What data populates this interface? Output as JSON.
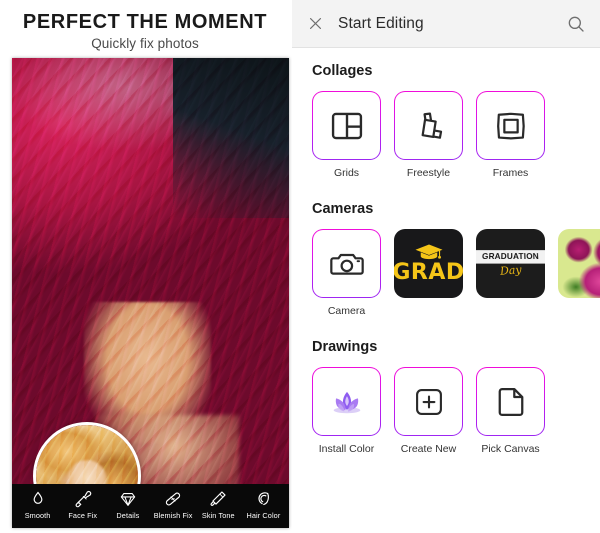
{
  "promo": {
    "title": "PERFECT THE MOMENT",
    "subtitle": "Quickly fix photos",
    "hero_photo": "woman-with-pink-hair-photo",
    "inset_photo": "woman-with-blonde-hair-thumbnail",
    "toolbar": [
      {
        "label": "Smooth",
        "icon": "droplet-icon"
      },
      {
        "label": "Face Fix",
        "icon": "brush-icon"
      },
      {
        "label": "Details",
        "icon": "diamond-icon"
      },
      {
        "label": "Blemish Fix",
        "icon": "bandage-icon"
      },
      {
        "label": "Skin Tone",
        "icon": "lipstick-icon"
      },
      {
        "label": "Hair Color",
        "icon": "hair-swirl-icon"
      }
    ]
  },
  "app": {
    "header": {
      "title": "Start Editing",
      "close_icon": "close-icon",
      "search_icon": "search-icon"
    },
    "sections": [
      {
        "title": "Collages",
        "items": [
          {
            "label": "Grids",
            "icon": "grid-layout-icon",
            "style": "outline"
          },
          {
            "label": "Freestyle",
            "icon": "stacked-cards-icon",
            "style": "outline"
          },
          {
            "label": "Frames",
            "icon": "nested-square-icon",
            "style": "outline"
          }
        ]
      },
      {
        "title": "Cameras",
        "items": [
          {
            "label": "Camera",
            "icon": "camera-icon",
            "style": "outline"
          },
          {
            "label": "",
            "icon": "grad-cap-thumbnail",
            "style": "thumb-grad",
            "thumb_text": "GRAD"
          },
          {
            "label": "",
            "icon": "graduation-day-thumbnail",
            "style": "thumb-gday",
            "thumb_text": "GRADUATION",
            "thumb_sub": "Day"
          },
          {
            "label": "",
            "icon": "pink-flowers-thumbnail",
            "style": "thumb-flowers"
          }
        ]
      },
      {
        "title": "Drawings",
        "items": [
          {
            "label": "Install Color",
            "icon": "lotus-icon",
            "style": "outline"
          },
          {
            "label": "Create New",
            "icon": "plus-square-icon",
            "style": "outline"
          },
          {
            "label": "Pick Canvas",
            "icon": "page-icon",
            "style": "outline"
          }
        ]
      }
    ]
  },
  "colors": {
    "tile_border_top": "#f20bd8",
    "tile_border_bottom": "#9a27f2",
    "grad_yellow": "#f5c518",
    "thumb_black": "#18181a",
    "header_bg": "#f3f3f3"
  }
}
